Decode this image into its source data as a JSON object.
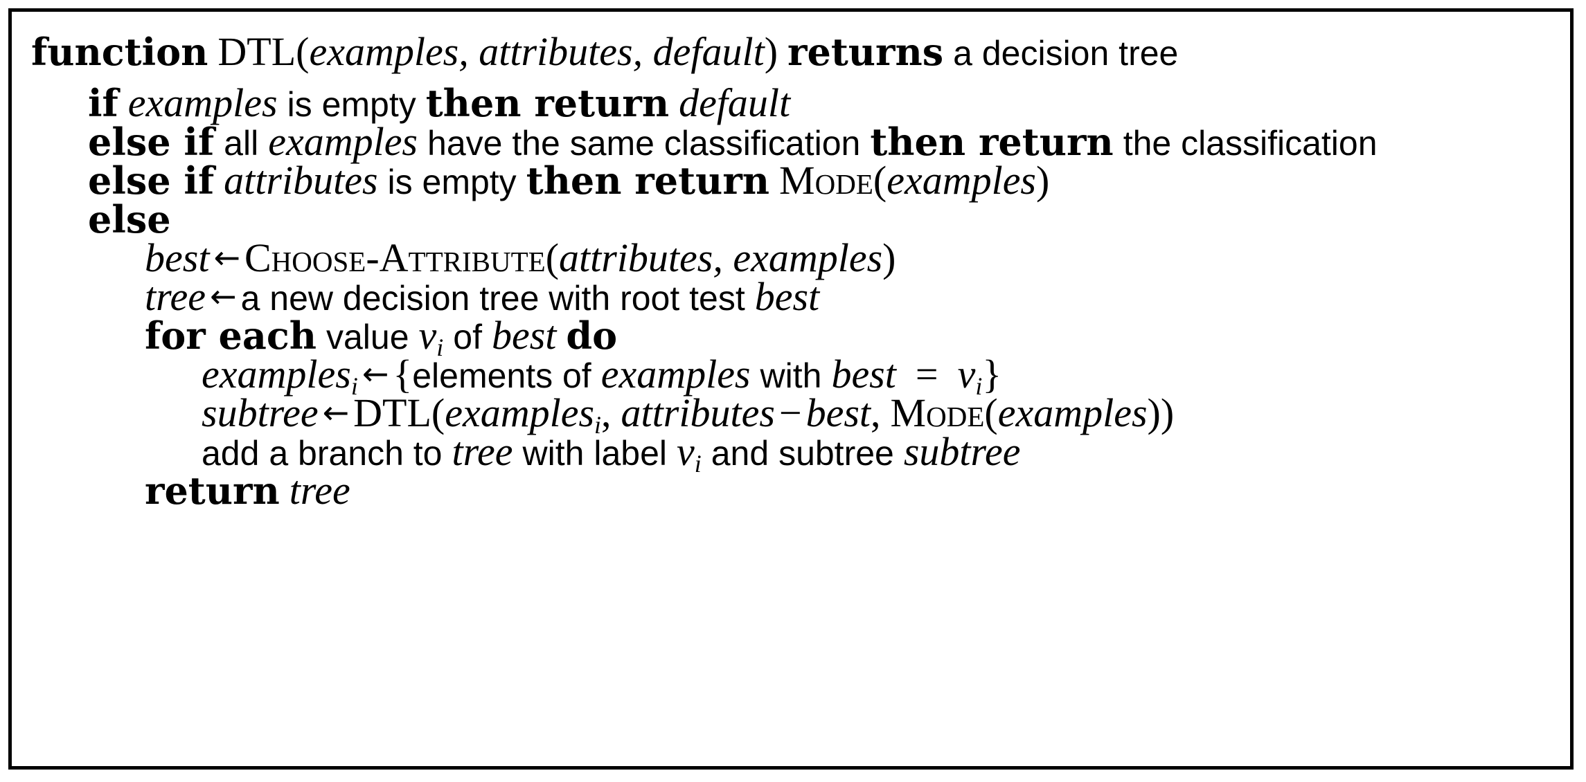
{
  "algorithm": {
    "signature": {
      "kw_function": "function",
      "name": "DTL",
      "open_paren": "(",
      "params": "examples, attributes, default",
      "close_paren": ")",
      "kw_returns": "returns",
      "returns_desc": "a decision tree"
    },
    "line1": {
      "kw_if": "if",
      "var_examples": "examples",
      "text_is_empty": "is empty",
      "kw_then_return": "then return",
      "var_default": "default"
    },
    "line2": {
      "kw_else_if": "else if",
      "text_all": "all",
      "var_examples": "examples",
      "text_have_same": "have the same classification",
      "kw_then_return": "then return",
      "text_classification": "the classification"
    },
    "line3": {
      "kw_else_if": "else if",
      "var_attributes": "attributes",
      "text_is_empty": "is empty",
      "kw_then_return": "then return",
      "fn_mode": "Mode",
      "open_paren": "(",
      "var_examples": "examples",
      "close_paren": ")"
    },
    "line4": {
      "kw_else": "else"
    },
    "line5": {
      "var_best": "best",
      "arrow": "←",
      "fn_choose": "Choose-Attribute",
      "open_paren": "(",
      "args": "attributes, examples",
      "close_paren": ")"
    },
    "line6": {
      "var_tree": "tree",
      "arrow": "←",
      "text_new_tree": "a new decision tree with root test",
      "var_best": "best"
    },
    "line7": {
      "kw_for_each": "for each",
      "text_value": "value",
      "var_v": "v",
      "sub_i": "i",
      "text_of": "of",
      "var_best": "best",
      "kw_do": "do"
    },
    "line8": {
      "var_examples": "examples",
      "sub_i": "i",
      "arrow": "←",
      "open_brace": "{",
      "text_elements_of": "elements of",
      "text_with": "with",
      "var_best": "best",
      "equals": "=",
      "var_v": "v",
      "sub_i2": "i",
      "close_brace": "}"
    },
    "line9": {
      "var_subtree": "subtree",
      "arrow": "←",
      "fn_dtl": "DTL",
      "open_paren": "(",
      "var_examples": "examples",
      "sub_i": "i",
      "comma": ",",
      "var_attributes": "attributes",
      "minus": "−",
      "var_best": "best",
      "comma2": ",",
      "fn_mode": "Mode",
      "open_paren2": "(",
      "var_examples2": "examples",
      "close_parens": "))"
    },
    "line10": {
      "text_add_branch": "add a branch to",
      "var_tree": "tree",
      "text_with_label": "with label",
      "var_v": "v",
      "sub_i": "i",
      "text_and_subtree": "and subtree",
      "var_subtree": "subtree"
    },
    "line11": {
      "kw_return": "return",
      "var_tree": "tree"
    }
  }
}
